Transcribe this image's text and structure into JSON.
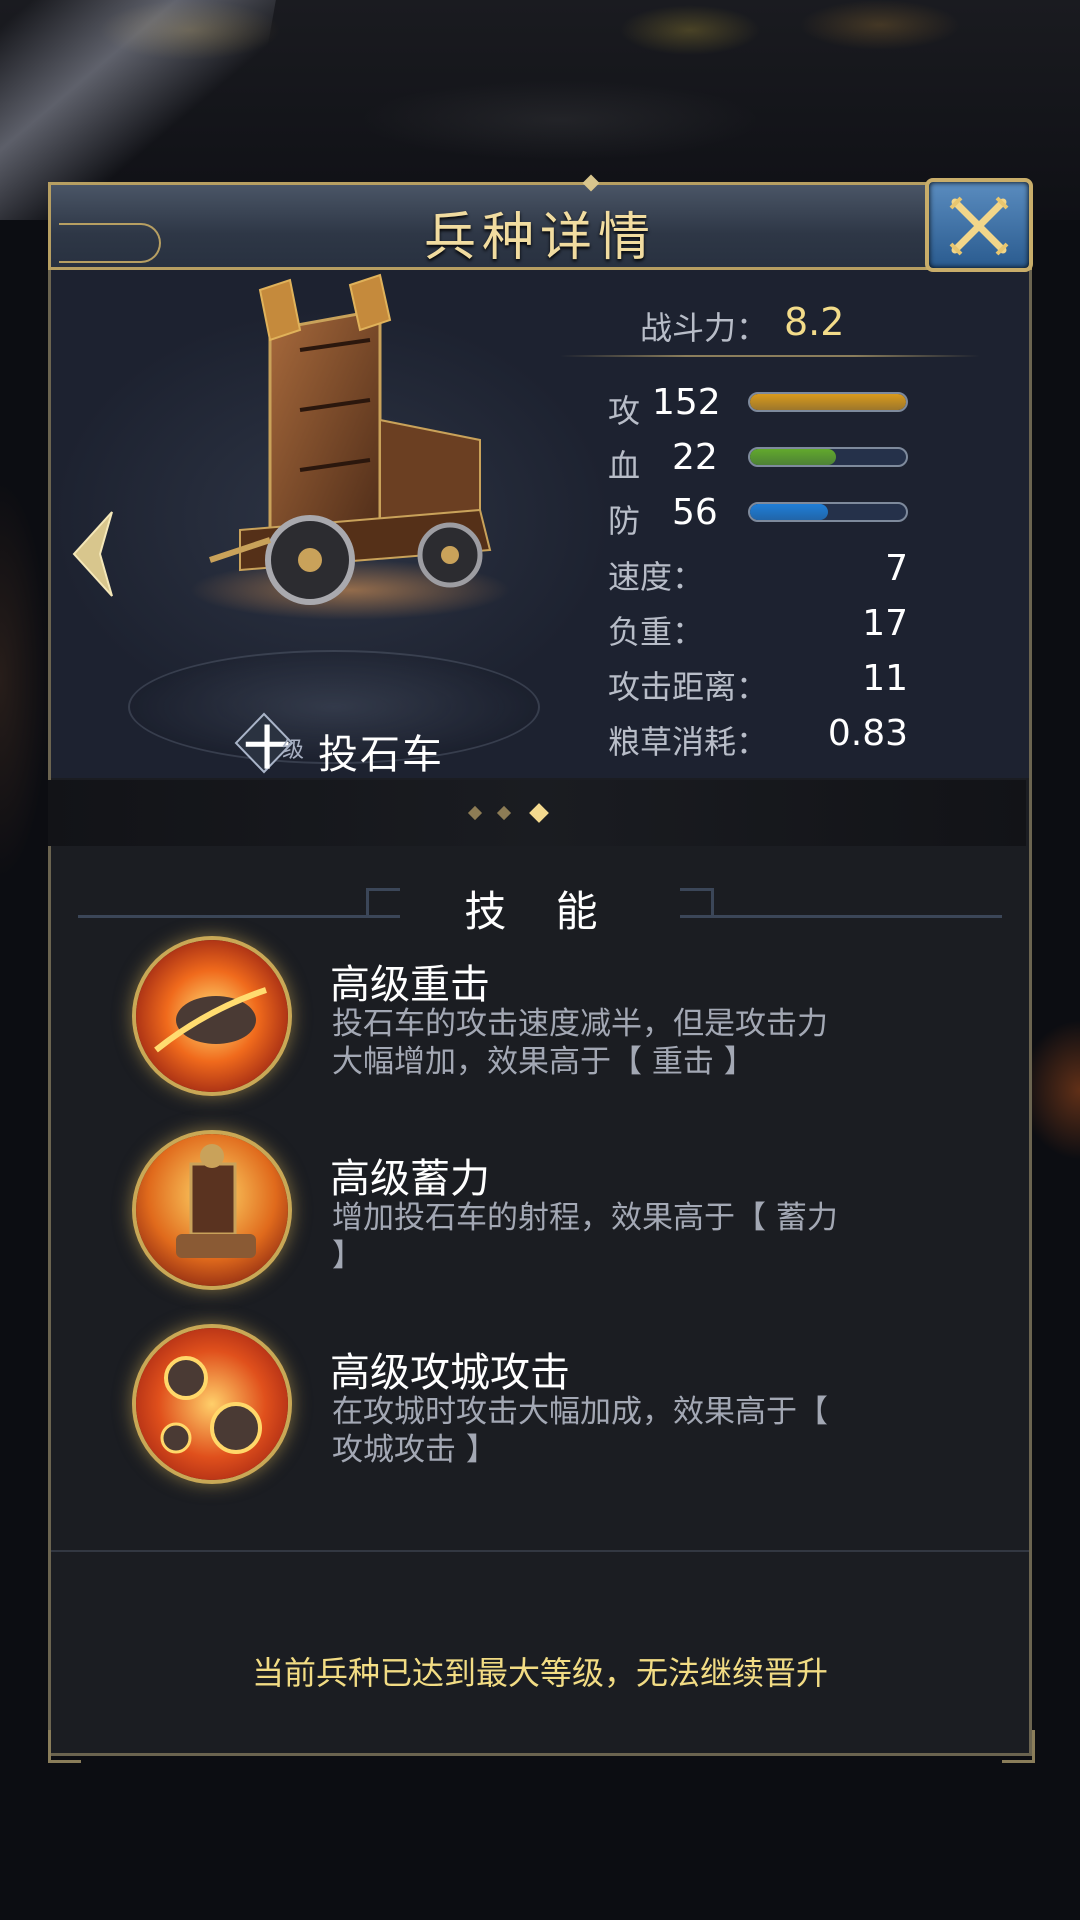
{
  "header": {
    "title": "兵种详情",
    "close_icon": "close-x-icon"
  },
  "unit": {
    "level_prefix": "十",
    "level_suffix": "级",
    "name": "投石车",
    "image": "siege-catapult-image"
  },
  "power": {
    "label": "战斗力：",
    "value": "8.2"
  },
  "stats": [
    {
      "label": "攻",
      "value": "152",
      "fill": 1.0,
      "color": "#d99a1c"
    },
    {
      "label": "血",
      "value": "22",
      "fill": 0.55,
      "color": "#62a92c"
    },
    {
      "label": "防",
      "value": "56",
      "fill": 0.5,
      "color": "#1f7fd8"
    }
  ],
  "info": [
    {
      "label": "速度：",
      "value": "7"
    },
    {
      "label": "负重：",
      "value": "17"
    },
    {
      "label": "攻击距离：",
      "value": "11"
    },
    {
      "label": "粮草消耗：",
      "value": "0.83"
    }
  ],
  "pager": {
    "count": 3,
    "active": 3
  },
  "skills": {
    "title": "技 能",
    "items": [
      {
        "name": "高级重击",
        "desc_line1": "投石车的攻击速度减半，但是攻击力",
        "desc_line2": "大幅增加，效果高于【 重击 】",
        "icon": "flaming-boulder-icon"
      },
      {
        "name": "高级蓄力",
        "desc_line1": "增加投石车的射程，效果高于【 蓄力",
        "desc_line2": "】",
        "icon": "catapult-winch-icon"
      },
      {
        "name": "高级攻城攻击",
        "desc_line1": "在攻城时攻击大幅加成，效果高于【",
        "desc_line2": "攻城攻击 】",
        "icon": "fire-projectiles-icon"
      }
    ]
  },
  "footer": {
    "message": "当前兵种已达到最大等级，无法继续晋升"
  }
}
